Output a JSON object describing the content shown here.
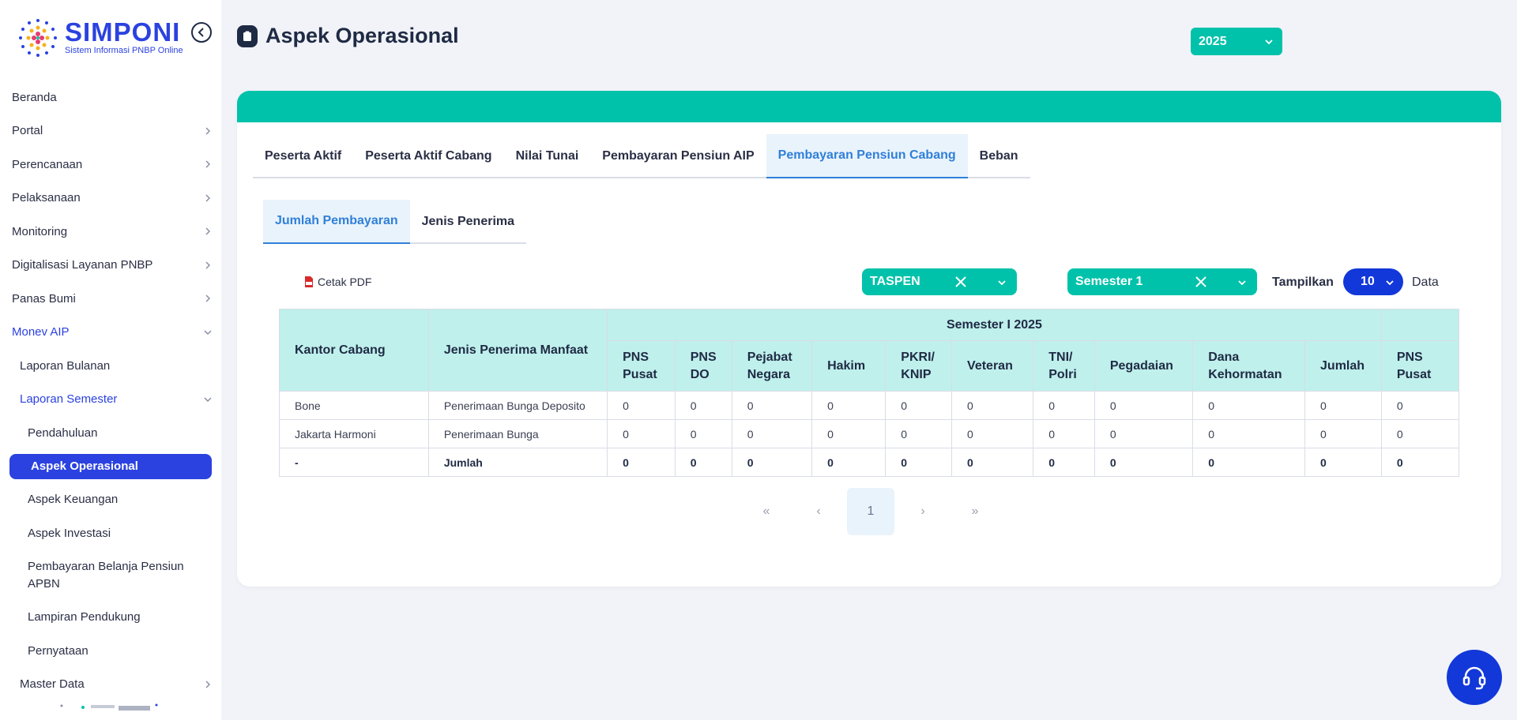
{
  "brand": {
    "name": "SIMPONI",
    "subtitle": "Sistem Informasi PNBP Online"
  },
  "sidebar": {
    "items": [
      {
        "label": "Beranda"
      },
      {
        "label": "Portal"
      },
      {
        "label": "Perencanaan"
      },
      {
        "label": "Pelaksanaan"
      },
      {
        "label": "Monitoring"
      },
      {
        "label": "Digitalisasi Layanan PNBP"
      },
      {
        "label": "Panas Bumi"
      },
      {
        "label": "Monev AIP"
      },
      {
        "label": "Laporan Bulanan"
      },
      {
        "label": "Laporan Semester"
      },
      {
        "label": "Pendahuluan"
      },
      {
        "label": "Aspek Operasional"
      },
      {
        "label": "Aspek Keuangan"
      },
      {
        "label": "Aspek Investasi"
      },
      {
        "label": "Pembayaran Belanja Pensiun APBN"
      },
      {
        "label": "Lampiran Pendukung"
      },
      {
        "label": "Pernyataan"
      },
      {
        "label": "Master Data"
      }
    ]
  },
  "header": {
    "title": "Aspek Operasional",
    "year": "2025"
  },
  "tabs": [
    {
      "label": "Peserta Aktif"
    },
    {
      "label": "Peserta Aktif Cabang"
    },
    {
      "label": "Nilai Tunai"
    },
    {
      "label": "Pembayaran Pensiun AIP"
    },
    {
      "label": "Pembayaran Pensiun Cabang"
    },
    {
      "label": "Beban"
    }
  ],
  "subtabs": [
    {
      "label": "Jumlah Pembayaran"
    },
    {
      "label": "Jenis Penerima"
    }
  ],
  "toolbar": {
    "pdf_label": "Cetak PDF",
    "filter1": "TASPEN",
    "filter2": "Semester 1",
    "show_label": "Tampilkan",
    "show_value": "10",
    "data_label": "Data"
  },
  "table": {
    "col_kantor": "Kantor Cabang",
    "col_jenis": "Jenis Penerima Manfaat",
    "group_label": "Semester I 2025",
    "sub_headers": [
      [
        "PNS",
        "Pusat"
      ],
      [
        "PNS",
        "DO"
      ],
      [
        "Pejabat",
        "Negara"
      ],
      [
        "Hakim"
      ],
      [
        "PKRI/",
        "KNIP"
      ],
      [
        "Veteran"
      ],
      [
        "TNI/",
        "Polri"
      ],
      [
        "Pegadaian"
      ],
      [
        "Dana",
        "Kehormatan"
      ],
      [
        "Jumlah"
      ],
      [
        "PNS",
        "Pusat"
      ]
    ],
    "rows": [
      {
        "kantor": "Bone",
        "jenis": "Penerimaan Bunga Deposito",
        "values": [
          "0",
          "0",
          "0",
          "0",
          "0",
          "0",
          "0",
          "0",
          "0",
          "0",
          "0"
        ]
      },
      {
        "kantor": "Jakarta Harmoni",
        "jenis": "Penerimaan Bunga",
        "values": [
          "0",
          "0",
          "0",
          "0",
          "0",
          "0",
          "0",
          "0",
          "0",
          "0",
          "0"
        ]
      },
      {
        "kantor": "-",
        "jenis": "Jumlah",
        "values": [
          "0",
          "0",
          "0",
          "0",
          "0",
          "0",
          "0",
          "0",
          "0",
          "0",
          "0"
        ],
        "total": true
      }
    ]
  },
  "pagination": {
    "first": "«",
    "prev": "‹",
    "current": "1",
    "next": "›",
    "last": "»"
  },
  "colors": {
    "primary": "#2b42e0",
    "teal": "#00c2aa",
    "header_bg": "#bff0ec",
    "active_tab": "#2f7fd9",
    "dark_blue": "#1238d9"
  }
}
